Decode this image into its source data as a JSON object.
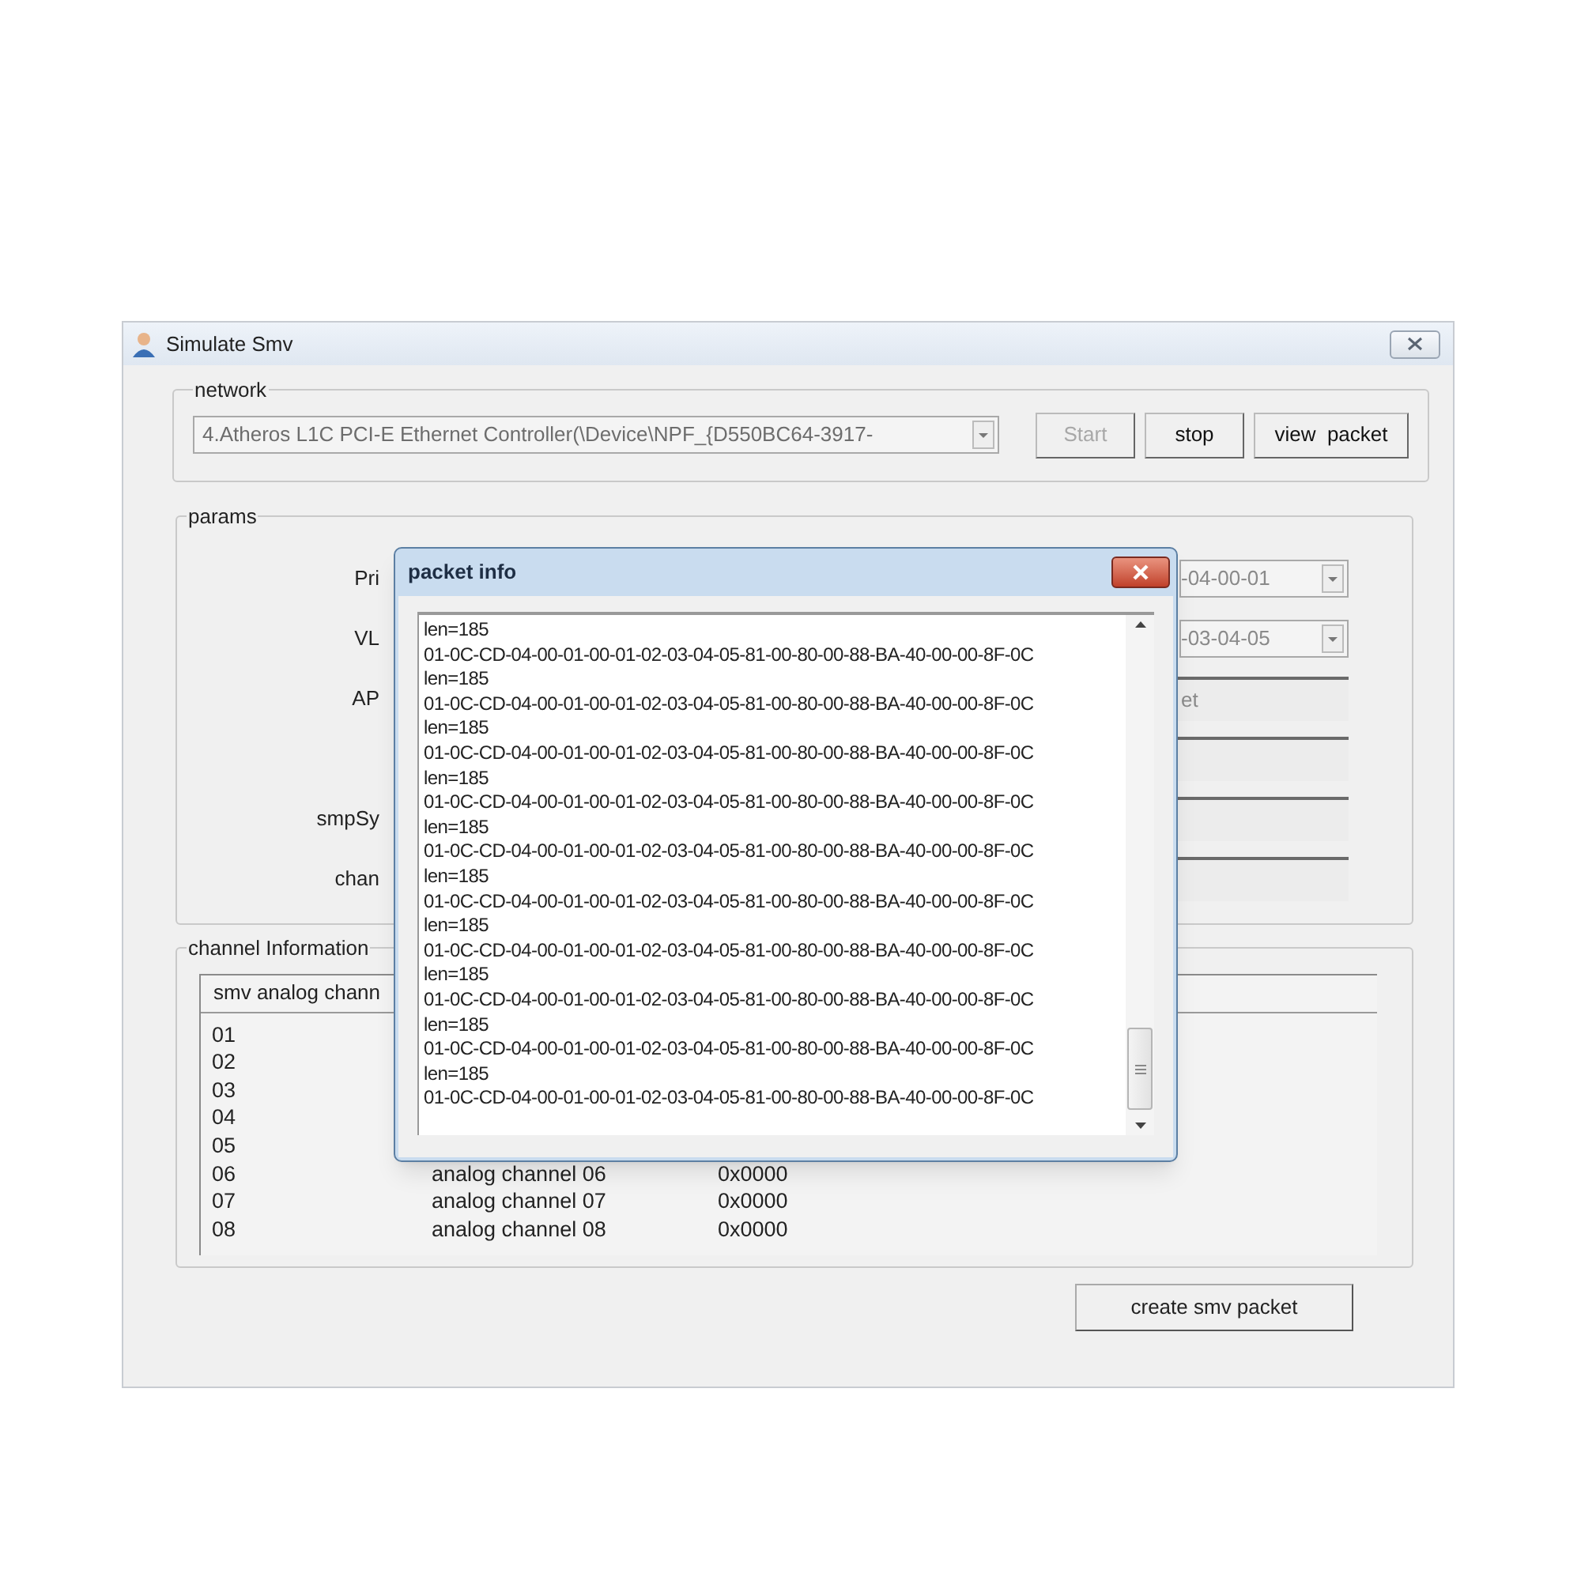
{
  "window": {
    "title": "Simulate Smv"
  },
  "network": {
    "label": "network",
    "adapter": {
      "value": "4.Atheros L1C PCI-E Ethernet Controller(\\Device\\NPF_{D550BC64-3917-",
      "disabled": true
    },
    "buttons": [
      {
        "label": "Start",
        "disabled": true
      },
      {
        "label": "stop",
        "disabled": false
      },
      {
        "label": "view  packet",
        "disabled": false
      }
    ]
  },
  "params": {
    "label": "params",
    "rows": [
      {
        "label": "Pri",
        "kind": "combo",
        "value": "-04-00-01"
      },
      {
        "label": "VL",
        "kind": "combo",
        "value": "-03-04-05"
      },
      {
        "label": "AP",
        "kind": "text",
        "value": "et"
      },
      {
        "kind": "text"
      },
      {
        "label": "smpSy",
        "kind": "text"
      },
      {
        "label": "chan",
        "kind": "text"
      }
    ]
  },
  "channel_information": {
    "label": "channel Information",
    "columns": [
      "smv analog chann"
    ],
    "rows": [
      {
        "number": "01"
      },
      {
        "number": "02"
      },
      {
        "number": "03"
      },
      {
        "number": "04"
      },
      {
        "number": "05"
      },
      {
        "number": "06",
        "name": "analog channel 06",
        "value": "0x0000"
      },
      {
        "number": "07",
        "name": "analog channel 07",
        "value": "0x0000"
      },
      {
        "number": "08",
        "name": "analog channel 08",
        "value": "0x0000"
      }
    ]
  },
  "create_button": {
    "label": "create smv packet"
  },
  "packet_info": {
    "title": "packet info",
    "lines": [
      "len=185",
      "01-0C-CD-04-00-01-00-01-02-03-04-05-81-00-80-00-88-BA-40-00-00-8F-0C",
      "len=185",
      "01-0C-CD-04-00-01-00-01-02-03-04-05-81-00-80-00-88-BA-40-00-00-8F-0C",
      "len=185",
      "01-0C-CD-04-00-01-00-01-02-03-04-05-81-00-80-00-88-BA-40-00-00-8F-0C",
      "len=185",
      "01-0C-CD-04-00-01-00-01-02-03-04-05-81-00-80-00-88-BA-40-00-00-8F-0C",
      "len=185",
      "01-0C-CD-04-00-01-00-01-02-03-04-05-81-00-80-00-88-BA-40-00-00-8F-0C",
      "len=185",
      "01-0C-CD-04-00-01-00-01-02-03-04-05-81-00-80-00-88-BA-40-00-00-8F-0C",
      "len=185",
      "01-0C-CD-04-00-01-00-01-02-03-04-05-81-00-80-00-88-BA-40-00-00-8F-0C",
      "len=185",
      "01-0C-CD-04-00-01-00-01-02-03-04-05-81-00-80-00-88-BA-40-00-00-8F-0C",
      "len=185",
      "01-0C-CD-04-00-01-00-01-02-03-04-05-81-00-80-00-88-BA-40-00-00-8F-0C",
      "len=185",
      "01-0C-CD-04-00-01-00-01-02-03-04-05-81-00-80-00-88-BA-40-00-00-8F-0C"
    ]
  }
}
